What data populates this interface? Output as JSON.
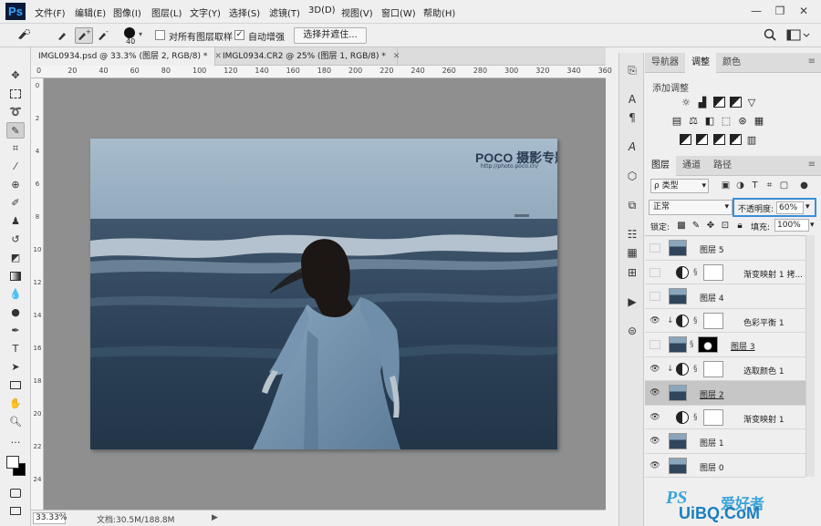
{
  "app": {
    "logo": "Ps"
  },
  "menu": [
    "文件(F)",
    "编辑(E)",
    "图像(I)",
    "图层(L)",
    "文字(Y)",
    "选择(S)",
    "滤镜(T)",
    "3D(D)",
    "视图(V)",
    "窗口(W)",
    "帮助(H)"
  ],
  "window_controls": {
    "minimize": "—",
    "restore": "❐",
    "close": "✕"
  },
  "options": {
    "brush_size": "40",
    "sample_all_layers": "对所有图层取样",
    "sample_all_layers_checked": false,
    "auto_enhance": "自动增强",
    "auto_enhance_checked": true,
    "select_and_mask": "选择并遮住..."
  },
  "doc_tabs": [
    {
      "title": "IMGL0934.psd @ 33.3% (图层 2, RGB/8) *",
      "close": "✕"
    },
    {
      "title": "IMGL0934.CR2 @ 25% (图层 1, RGB/8) *",
      "close": "✕"
    }
  ],
  "ruler_h": [
    "0",
    "20",
    "40",
    "60",
    "80",
    "100",
    "120",
    "140",
    "160",
    "180",
    "200",
    "220",
    "240",
    "260",
    "280",
    "300",
    "320",
    "340",
    "360"
  ],
  "ruler_v": [
    "0",
    "2",
    "4",
    "6",
    "8",
    "10",
    "12",
    "14",
    "16",
    "18",
    "20",
    "22",
    "24"
  ],
  "watermark": {
    "brand": "POCO 摄影专题",
    "url": "http://photo.poco.cn/"
  },
  "status": {
    "zoom": "33.33%",
    "doc_info": "文档:30.5M/188.8M"
  },
  "panels": {
    "top_tabs": [
      "导航器",
      "调整",
      "颜色"
    ],
    "adjustments_title": "添加调整",
    "layer_tabs": [
      "图层",
      "通道",
      "路径"
    ],
    "filter_kind": "类型",
    "blend_mode": "正常",
    "opacity_label": "不透明度:",
    "opacity_value": "60%",
    "lock_label": "锁定:",
    "fill_label": "填充:",
    "fill_value": "100%"
  },
  "layers": [
    {
      "name": "图层 5",
      "kind": "pixel",
      "visible": false
    },
    {
      "name": "渐变映射 1 拷...",
      "kind": "adjustment",
      "visible": false
    },
    {
      "name": "图层 4",
      "kind": "pixel",
      "visible": false
    },
    {
      "name": "色彩平衡 1",
      "kind": "adjustment",
      "visible": true,
      "clipped": true
    },
    {
      "name": "图层 3",
      "kind": "masked",
      "visible": false
    },
    {
      "name": "选取颜色 1",
      "kind": "adjustment",
      "visible": true,
      "clipped": true
    },
    {
      "name": "图层 2",
      "kind": "pixel",
      "visible": true,
      "selected": true
    },
    {
      "name": "渐变映射 1",
      "kind": "adjustment",
      "visible": true
    },
    {
      "name": "图层 1",
      "kind": "pixel",
      "visible": true
    },
    {
      "name": "图层 0",
      "kind": "pixel",
      "visible": true
    }
  ],
  "corner_watermark": {
    "ps": "PS",
    "cn": "爱好者",
    "site": "UiBQ.CoM"
  },
  "colors": {
    "selection_highlight": "#3a8fd8",
    "canvas_bg": "#8f8f8f",
    "sea_dark": "#2d4258",
    "sky": "#9eb6c9"
  }
}
